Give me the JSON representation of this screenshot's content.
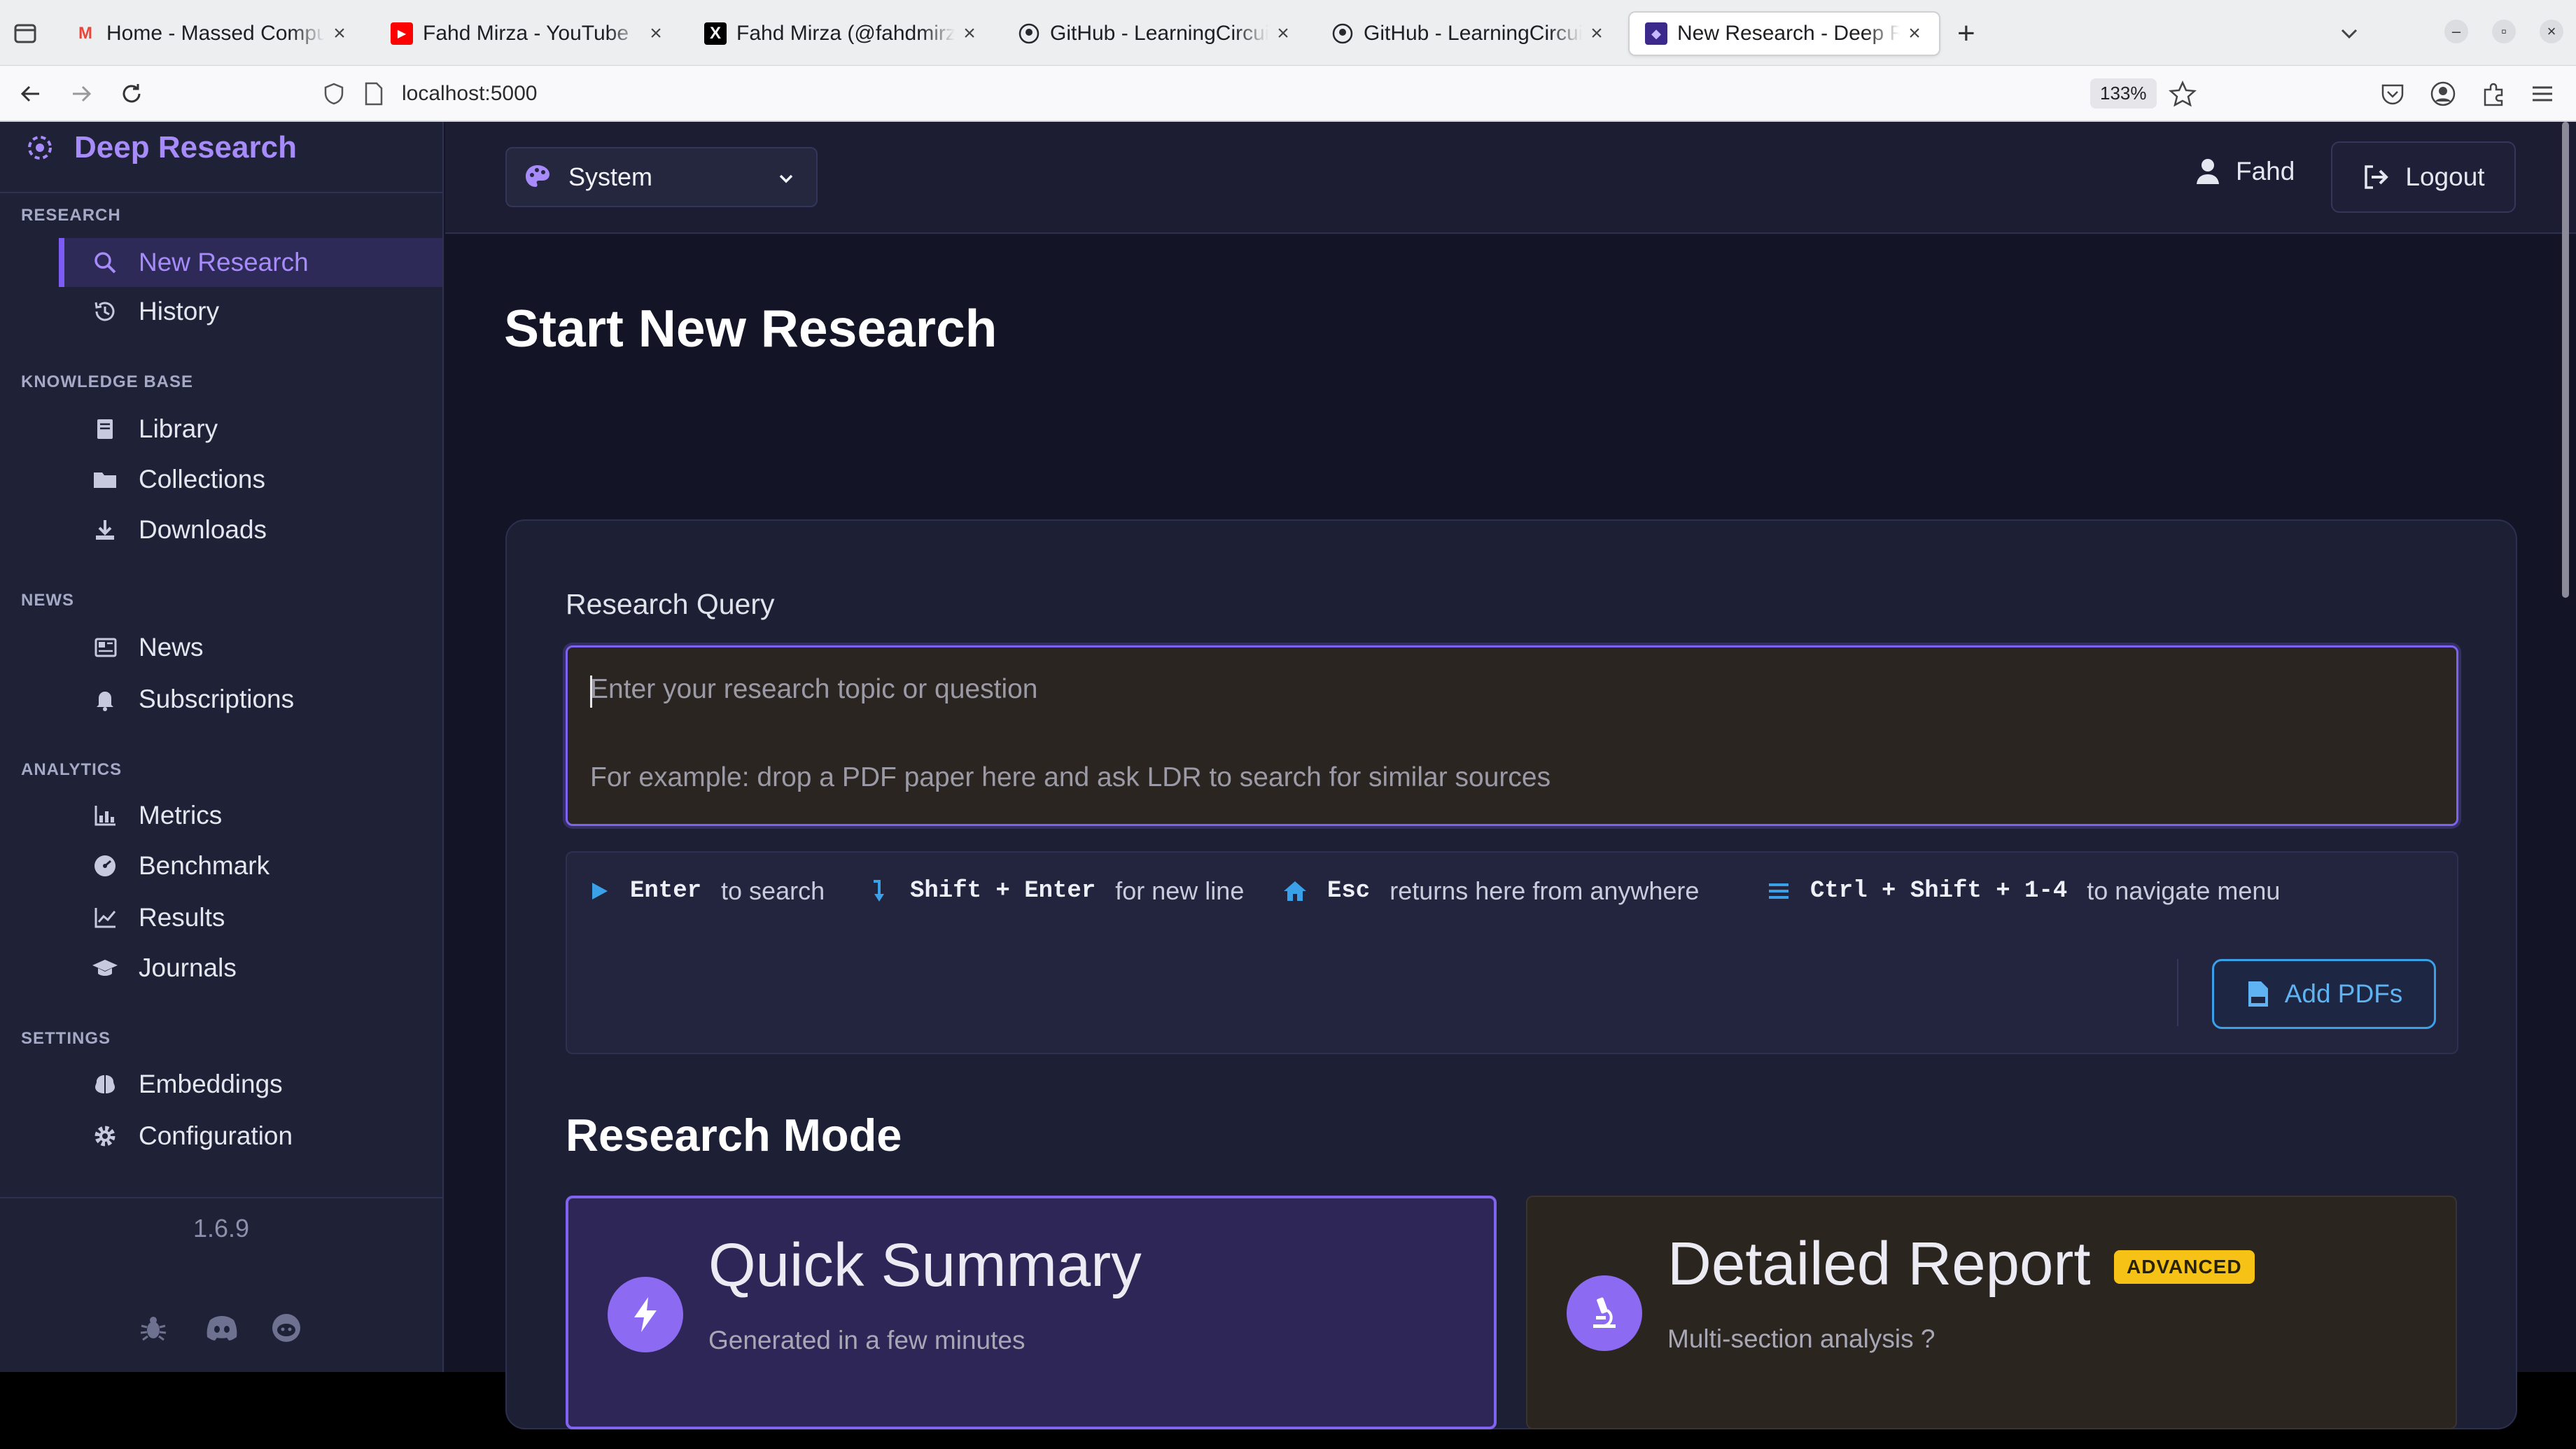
{
  "browser": {
    "tabs": [
      {
        "title": "Home - Massed Compute",
        "favicon_color": "#e8463a",
        "favicon_glyph": "M"
      },
      {
        "title": "Fahd Mirza - YouTube",
        "favicon_color": "#ff0000",
        "favicon_glyph": "▶"
      },
      {
        "title": "Fahd Mirza (@fahdmirza)",
        "favicon_color": "#000000",
        "favicon_glyph": "X"
      },
      {
        "title": "GitHub - LearningCircuit/",
        "favicon_color": "#24292f",
        "favicon_glyph": ""
      },
      {
        "title": "GitHub - LearningCircuit/",
        "favicon_color": "#24292f",
        "favicon_glyph": ""
      },
      {
        "title": "New Research - Deep Re",
        "favicon_color": "#3b2a8c",
        "favicon_glyph": "◆"
      }
    ],
    "active_tab_index": 5,
    "url": "localhost:5000",
    "zoom": "133%"
  },
  "sidebar": {
    "brand": "Deep Research",
    "sections": [
      {
        "title": "RESEARCH",
        "items": [
          {
            "label": "New Research",
            "icon": "search-icon",
            "active": true
          },
          {
            "label": "History",
            "icon": "history-icon"
          }
        ]
      },
      {
        "title": "KNOWLEDGE BASE",
        "items": [
          {
            "label": "Library",
            "icon": "book-icon"
          },
          {
            "label": "Collections",
            "icon": "folder-icon"
          },
          {
            "label": "Downloads",
            "icon": "download-icon"
          }
        ]
      },
      {
        "title": "NEWS",
        "items": [
          {
            "label": "News",
            "icon": "newspaper-icon"
          },
          {
            "label": "Subscriptions",
            "icon": "bell-icon"
          }
        ]
      },
      {
        "title": "ANALYTICS",
        "items": [
          {
            "label": "Metrics",
            "icon": "bar-chart-icon"
          },
          {
            "label": "Benchmark",
            "icon": "gauge-icon"
          },
          {
            "label": "Results",
            "icon": "line-chart-icon"
          },
          {
            "label": "Journals",
            "icon": "graduation-cap-icon"
          }
        ]
      },
      {
        "title": "SETTINGS",
        "items": [
          {
            "label": "Embeddings",
            "icon": "brain-icon"
          },
          {
            "label": "Configuration",
            "icon": "gear-icon"
          }
        ]
      }
    ],
    "version": "1.6.9",
    "footer_icons": [
      "bug-icon",
      "discord-icon",
      "reddit-icon"
    ]
  },
  "topbar": {
    "theme": "System",
    "user": "Fahd",
    "logout": "Logout"
  },
  "main": {
    "title": "Start New Research",
    "query_label": "Research Query",
    "query_placeholder_1": "Enter your research topic or question",
    "query_placeholder_2": "For example: drop a PDF paper here and ask LDR to search for similar sources",
    "hints": [
      {
        "keys": "Enter",
        "text": "to search",
        "icon": "play-icon"
      },
      {
        "keys": "Shift + Enter",
        "text": "for new line",
        "icon": "return-arrow-icon"
      },
      {
        "keys": "Esc",
        "text": "returns here from anywhere",
        "icon": "home-icon"
      },
      {
        "keys": "Ctrl + Shift + 1-4",
        "text": "to navigate menu",
        "icon": "menu-icon"
      }
    ],
    "add_pdfs": "Add PDFs",
    "mode_title": "Research Mode",
    "modes": [
      {
        "title": "Quick Summary",
        "subtitle": "Generated in a few minutes",
        "icon": "bolt-icon",
        "selected": true
      },
      {
        "title": "Detailed Report",
        "subtitle": "Multi-section analysis ?",
        "icon": "microscope-icon",
        "badge": "ADVANCED"
      }
    ]
  },
  "colors": {
    "accent": "#8063ee",
    "brand": "#a78bfa",
    "badge": "#f6c215",
    "link_blue": "#5fb3f2"
  }
}
